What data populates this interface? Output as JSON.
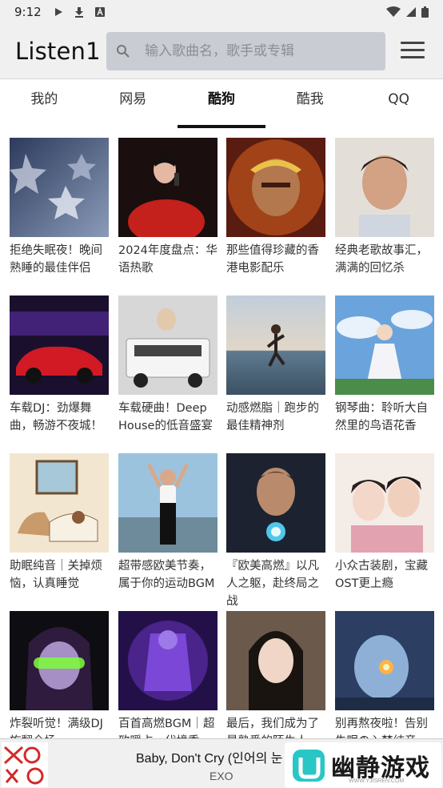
{
  "status": {
    "time": "9:12"
  },
  "app": {
    "title": "Listen1"
  },
  "search": {
    "placeholder": "输入歌曲名，歌手或专辑"
  },
  "tabs": [
    {
      "label": "我的"
    },
    {
      "label": "网易"
    },
    {
      "label": "酷狗",
      "active": true
    },
    {
      "label": "酷我"
    },
    {
      "label": "QQ"
    }
  ],
  "playlists": [
    {
      "title": "拒绝失眠夜！晚间熟睡的最佳伴侣"
    },
    {
      "title": "2024年度盘点：华语热歌"
    },
    {
      "title": "那些值得珍藏的香港电影配乐"
    },
    {
      "title": "经典老歌故事汇，满满的回忆杀"
    },
    {
      "title": "车载DJ：劲爆舞曲，畅游不夜城！"
    },
    {
      "title": "车载硬曲！Deep House的低音盛宴"
    },
    {
      "title": "动感燃脂｜跑步的最佳精神剂"
    },
    {
      "title": "钢琴曲：聆听大自然里的鸟语花香"
    },
    {
      "title": "助眠纯音｜关掉烦恼，认真睡觉"
    },
    {
      "title": "超带感欧美节奏，属于你的运动BGM"
    },
    {
      "title": "『欧美高燃』以凡人之躯，赴终局之战"
    },
    {
      "title": "小众古装剧，宝藏OST更上瘾"
    },
    {
      "title": "炸裂听觉！满级DJ旋翻全场"
    },
    {
      "title": "百首高燃BGM｜超致暖占，代境秀"
    },
    {
      "title": "最后，我们成为了最熟悉的陌生人"
    },
    {
      "title": "别再熬夜啦！告别失眠の入梦纯音"
    }
  ],
  "player": {
    "title": "Baby, Don't Cry (인어의 눈",
    "artist": "EXO"
  },
  "watermark": {
    "text": "幽静游戏",
    "sub": "WWW.YJISREN.COM"
  }
}
